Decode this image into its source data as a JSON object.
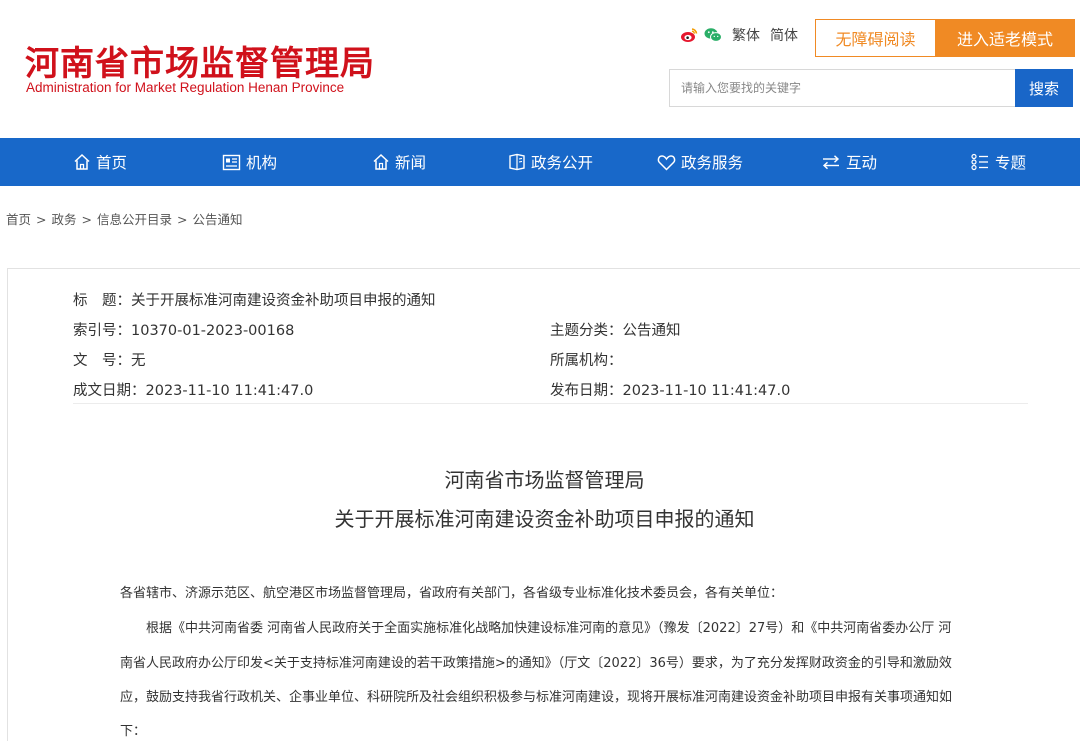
{
  "site": {
    "title_cn": "河南省市场监督管理局",
    "title_en": "Administration for Market Regulation Henan Province"
  },
  "toolbar": {
    "traditional": "繁体",
    "simplified": "简体",
    "accessible_reading": "无障碍阅读",
    "elder_mode": "进入适老模式"
  },
  "search": {
    "placeholder": "请输入您要找的关键字",
    "button": "搜索"
  },
  "nav": {
    "items": [
      {
        "label": "首页",
        "icon": "home-icon"
      },
      {
        "label": "机构",
        "icon": "organization-icon"
      },
      {
        "label": "新闻",
        "icon": "news-icon"
      },
      {
        "label": "政务公开",
        "icon": "open-government-icon"
      },
      {
        "label": "政务服务",
        "icon": "heart-service-icon"
      },
      {
        "label": "互动",
        "icon": "exchange-icon"
      },
      {
        "label": "专题",
        "icon": "topics-icon"
      }
    ]
  },
  "breadcrumb": {
    "items": [
      "首页",
      "政务",
      "信息公开目录",
      "公告通知"
    ],
    "separator": ">"
  },
  "meta": {
    "title_label": "标　题：",
    "title_value": "关于开展标准河南建设资金补助项目申报的通知",
    "index_label": "索引号：",
    "index_value": "10370-01-2023-00168",
    "topic_label": "主题分类：",
    "topic_value": "公告通知",
    "docno_label": "文　号：",
    "docno_value": "无",
    "org_label": "所属机构：",
    "org_value": "",
    "created_label": "成文日期：",
    "created_value": "2023-11-10 11:41:47.0",
    "published_label": "发布日期：",
    "published_value": "2023-11-10 11:41:47.0"
  },
  "article": {
    "title_line1": "河南省市场监督管理局",
    "title_line2": "关于开展标准河南建设资金补助项目申报的通知",
    "salutation": "各省辖市、济源示范区、航空港区市场监督管理局，省政府有关部门，各省级专业标准化技术委员会，各有关单位：",
    "para1_line1": "根据《中共河南省委 河南省人民政府关于全面实施标准化战略加快建设标准河南的意见》（豫发〔2022〕27号）和《中共河南省委办公厅 河",
    "para1_line2": "南省人民政府办公厅印发<关于支持标准河南建设的若干政策措施>的通知》（厅文〔2022〕36号）要求，为了充分发挥财政资金的引导和激励效",
    "para1_line3": "应，鼓励支持我省行政机关、企事业单位、科研院所及社会组织积极参与标准河南建设，现将开展标准河南建设资金补助项目申报有关事项通知如",
    "para1_line4": "下："
  },
  "colors": {
    "brand_red": "#d0111b",
    "nav_blue": "#1868c9",
    "search_blue": "#1966c8",
    "accent_orange": "#f08a24"
  }
}
